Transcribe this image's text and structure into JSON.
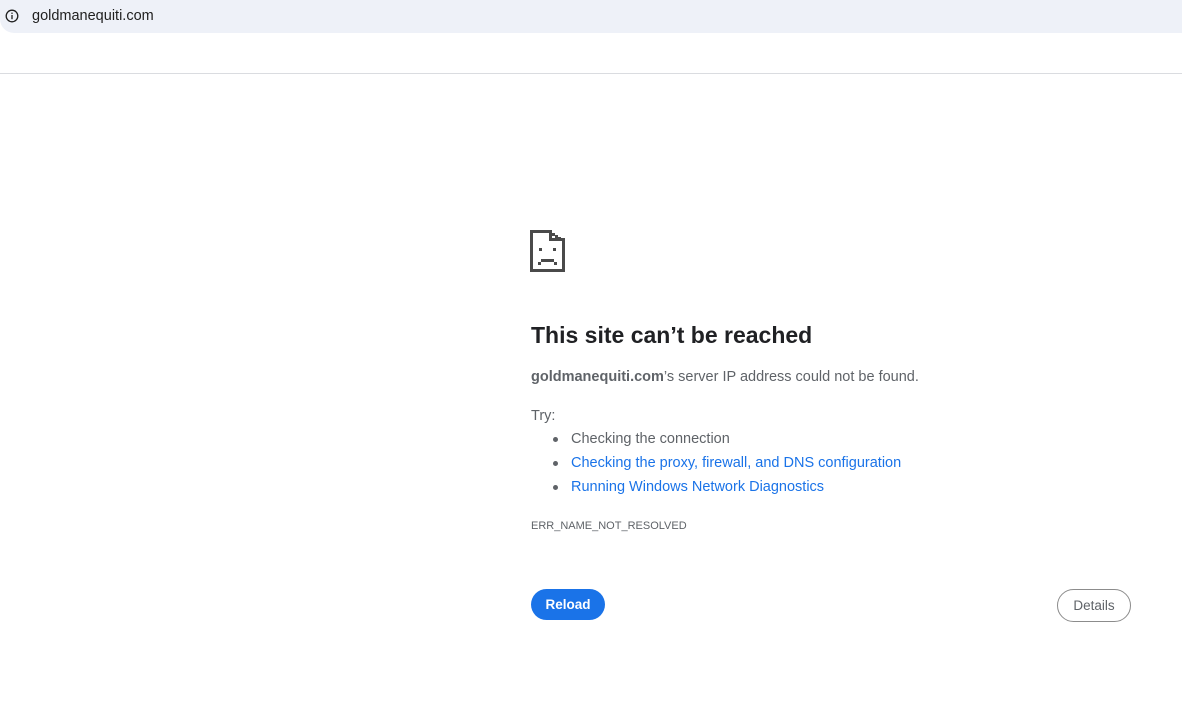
{
  "address_bar": {
    "url": "goldmanequiti.com",
    "site_info_icon": "info-icon"
  },
  "error": {
    "icon": "sad-page-icon",
    "heading": "This site can’t be reached",
    "host": "goldmanequiti.com",
    "summary_suffix": "’s server IP address could not be found.",
    "try_label": "Try:",
    "suggestions": [
      {
        "text": "Checking the connection",
        "is_link": false
      },
      {
        "text": "Checking the proxy, firewall, and DNS configuration",
        "is_link": true
      },
      {
        "text": "Running Windows Network Diagnostics",
        "is_link": true
      }
    ],
    "code": "ERR_NAME_NOT_RESOLVED"
  },
  "buttons": {
    "reload_label": "Reload",
    "details_label": "Details"
  },
  "colors": {
    "accent": "#1a73e8",
    "text_primary": "#202124",
    "text_secondary": "#5f6368",
    "address_bar_bg": "#eef1f8"
  }
}
